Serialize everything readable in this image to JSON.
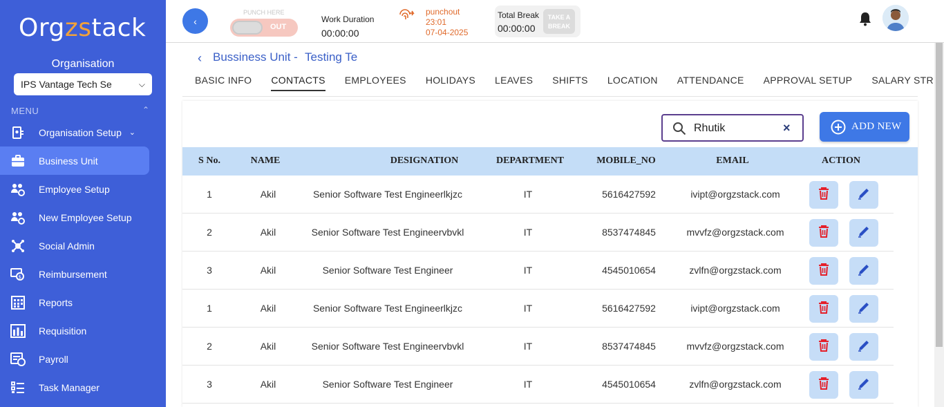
{
  "sidebar": {
    "logo": {
      "part1": "Org",
      "part2": "zs",
      "part3": "tack"
    },
    "org_label": "Organisation",
    "org_select": "IPS Vantage Tech Se",
    "menu_label": "MENU",
    "items": [
      {
        "label": "Organisation Setup",
        "icon": "org-setup-icon",
        "active": false,
        "expandable": true
      },
      {
        "label": "Business Unit",
        "icon": "briefcase-icon",
        "active": true,
        "expandable": false
      },
      {
        "label": "Employee Setup",
        "icon": "employee-setup-icon",
        "active": false,
        "expandable": false
      },
      {
        "label": "New Employee Setup",
        "icon": "new-employee-setup-icon",
        "active": false,
        "expandable": false
      },
      {
        "label": "Social Admin",
        "icon": "social-admin-icon",
        "active": false,
        "expandable": false
      },
      {
        "label": "Reimbursement",
        "icon": "reimbursement-icon",
        "active": false,
        "expandable": false
      },
      {
        "label": "Reports",
        "icon": "reports-icon",
        "active": false,
        "expandable": false
      },
      {
        "label": "Requisition",
        "icon": "requisition-icon",
        "active": false,
        "expandable": false
      },
      {
        "label": "Payroll",
        "icon": "payroll-icon",
        "active": false,
        "expandable": false
      },
      {
        "label": "Task Manager",
        "icon": "task-manager-icon",
        "active": false,
        "expandable": false
      }
    ]
  },
  "header": {
    "punch_caption": "PUNCH HERE",
    "punch_state": "OUT",
    "work_label": "Work Duration",
    "work_value": "00:00:00",
    "punchout_label": "punchout",
    "punchout_time": "23:01",
    "punchout_date": "07-04-2025",
    "break_label": "Total Break",
    "break_value": "00:00:00",
    "take_break_line1": "TAKE A",
    "take_break_line2": "BREAK"
  },
  "breadcrumb": {
    "unit": "Bussiness Unit -",
    "name": "Testing Te"
  },
  "tabs": [
    "BASIC INFO",
    "CONTACTS",
    "EMPLOYEES",
    "HOLIDAYS",
    "LEAVES",
    "SHIFTS",
    "LOCATION",
    "ATTENDANCE",
    "APPROVAL SETUP",
    "SALARY STRUCTUR"
  ],
  "active_tab": "CONTACTS",
  "search": {
    "value": "Rhutik"
  },
  "add_button": "ADD NEW",
  "table": {
    "headers": [
      "S No.",
      "NAME",
      "DESIGNATION",
      "DEPARTMENT",
      "MOBILE_NO",
      "EMAIL",
      "ACTION"
    ],
    "rows": [
      {
        "sno": "1",
        "name": "Akil",
        "designation": "Senior Software Test Engineerlkjzc",
        "department": "IT",
        "mobile": "5616427592",
        "email": "ivipt@orgzstack.com"
      },
      {
        "sno": "2",
        "name": "Akil",
        "designation": "Senior Software Test Engineervbvkl",
        "department": "IT",
        "mobile": "8537474845",
        "email": "mvvfz@orgzstack.com"
      },
      {
        "sno": "3",
        "name": "Akil",
        "designation": "Senior Software Test Engineer",
        "department": "IT",
        "mobile": "4545010654",
        "email": "zvlfn@orgzstack.com"
      },
      {
        "sno": "1",
        "name": "Akil",
        "designation": "Senior Software Test Engineerlkjzc",
        "department": "IT",
        "mobile": "5616427592",
        "email": "ivipt@orgzstack.com"
      },
      {
        "sno": "2",
        "name": "Akil",
        "designation": "Senior Software Test Engineervbvkl",
        "department": "IT",
        "mobile": "8537474845",
        "email": "mvvfz@orgzstack.com"
      },
      {
        "sno": "3",
        "name": "Akil",
        "designation": "Senior Software Test Engineer",
        "department": "IT",
        "mobile": "4545010654",
        "email": "zvlfn@orgzstack.com"
      }
    ]
  },
  "colors": {
    "sidebar_bg": "#3e5fd8",
    "accent": "#3e78e6",
    "table_header": "#c4ddf7",
    "delete_icon": "#e5202a",
    "edit_icon": "#2a4fc4",
    "punchout_text": "#e06a2b"
  }
}
